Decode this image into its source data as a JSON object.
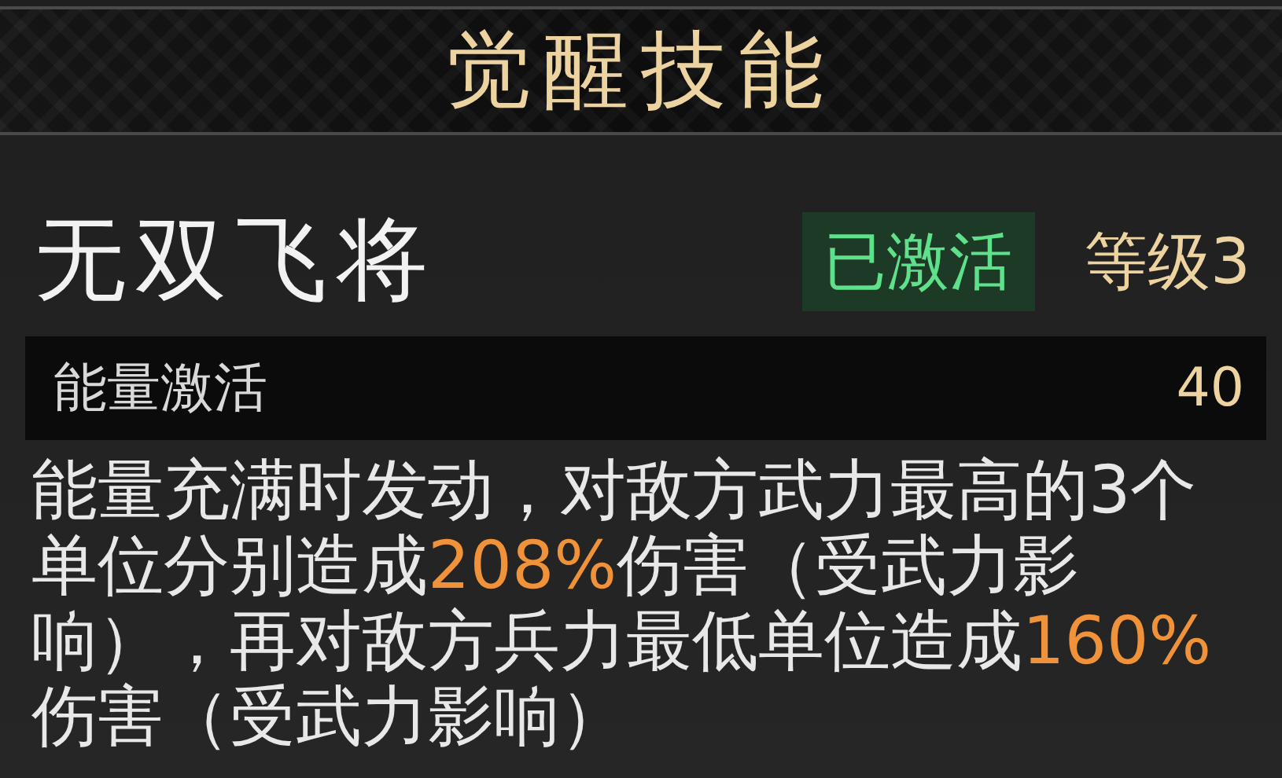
{
  "header": {
    "title": "觉醒技能"
  },
  "skill": {
    "name": "无双飞将",
    "activated": true,
    "status": "已激活",
    "level": "等级3"
  },
  "energy": {
    "label": "能量激活",
    "value": "40"
  },
  "description": [
    {
      "text": "能量充满时发动，对敌方武力最高的3个单位分别造成",
      "highlight": false
    },
    {
      "text": "208%",
      "highlight": true
    },
    {
      "text": "伤害（受武力影响），再对敌方兵力最低单位造成",
      "highlight": false
    },
    {
      "text": "160%",
      "highlight": true
    },
    {
      "text": "伤害（受武力影响）",
      "highlight": false
    }
  ]
}
